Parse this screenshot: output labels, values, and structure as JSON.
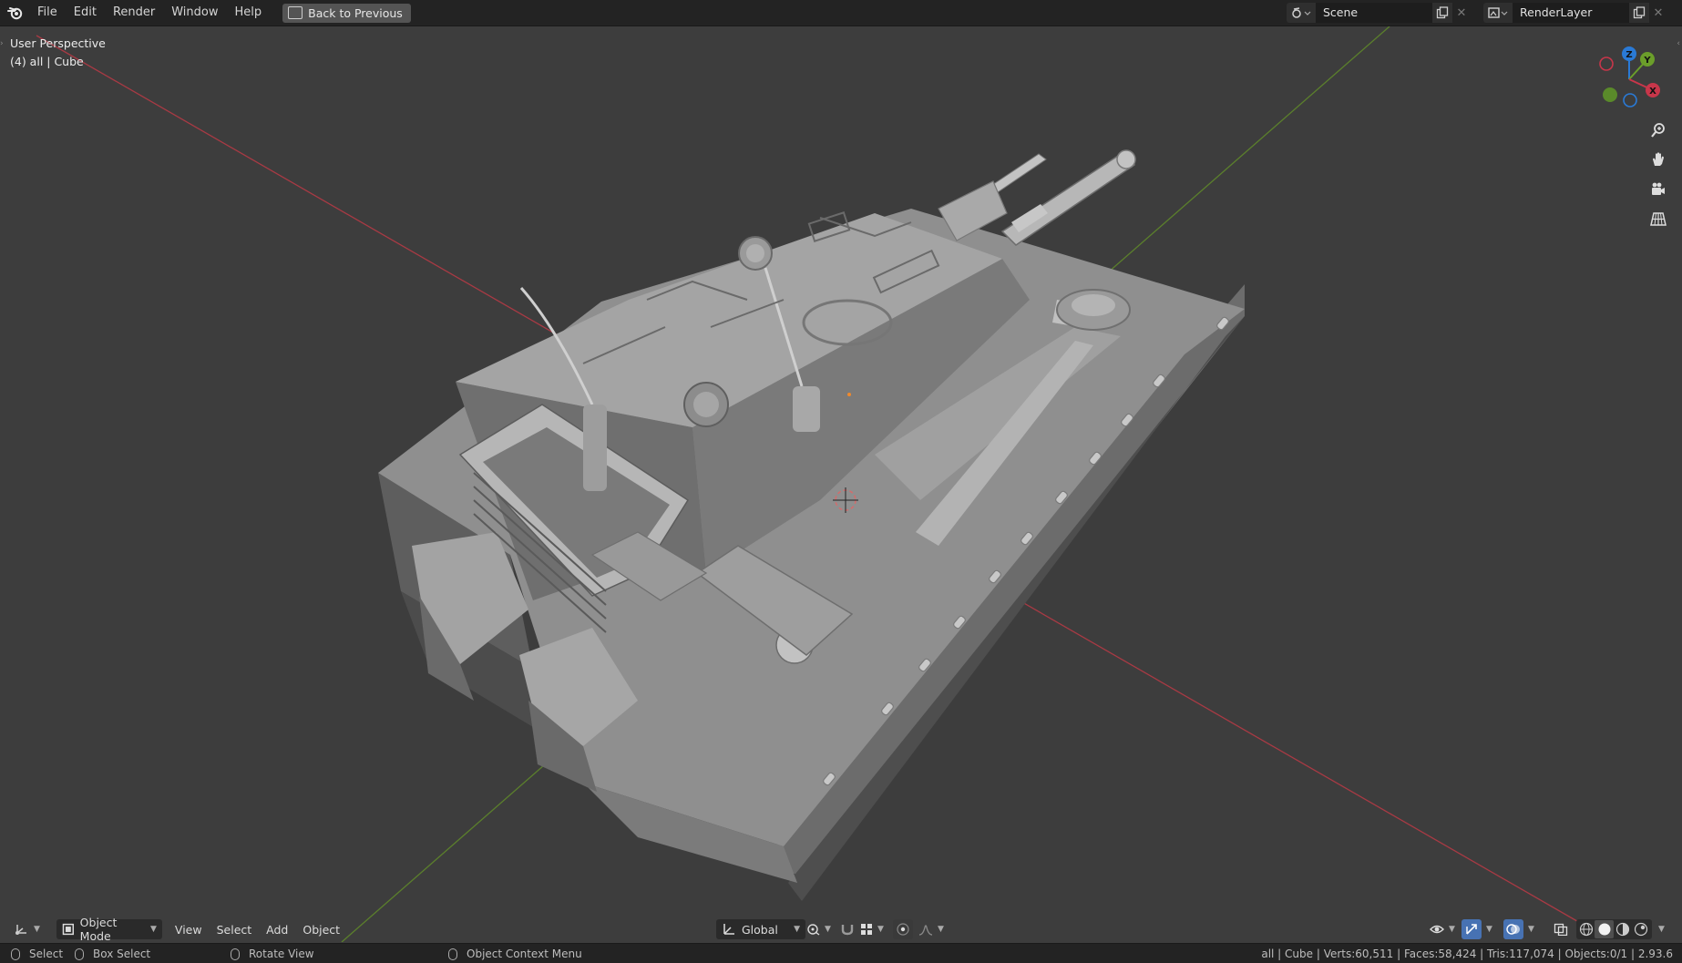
{
  "menu": {
    "items": [
      "File",
      "Edit",
      "Render",
      "Window",
      "Help"
    ],
    "back_label": "Back to Previous"
  },
  "scene": {
    "scene_name": "Scene",
    "render_layer": "RenderLayer"
  },
  "viewport": {
    "view_name": "User Perspective",
    "collection_info": "(4) all | Cube",
    "gizmo_axes": {
      "x": "X",
      "y": "Y",
      "z": "Z"
    },
    "axis_colors": {
      "x": "#c8364a",
      "y": "#6b9e2a",
      "z": "#2a7ad6"
    }
  },
  "header": {
    "mode": "Object Mode",
    "menus": [
      "View",
      "Select",
      "Add",
      "Object"
    ],
    "orientation": "Global"
  },
  "statusbar": {
    "select": "Select",
    "box_select": "Box Select",
    "rotate_view": "Rotate View",
    "context_menu": "Object Context Menu",
    "stats": "all | Cube | Verts:60,511 | Faces:58,424 | Tris:117,074 | Objects:0/1 | 2.93.6"
  }
}
